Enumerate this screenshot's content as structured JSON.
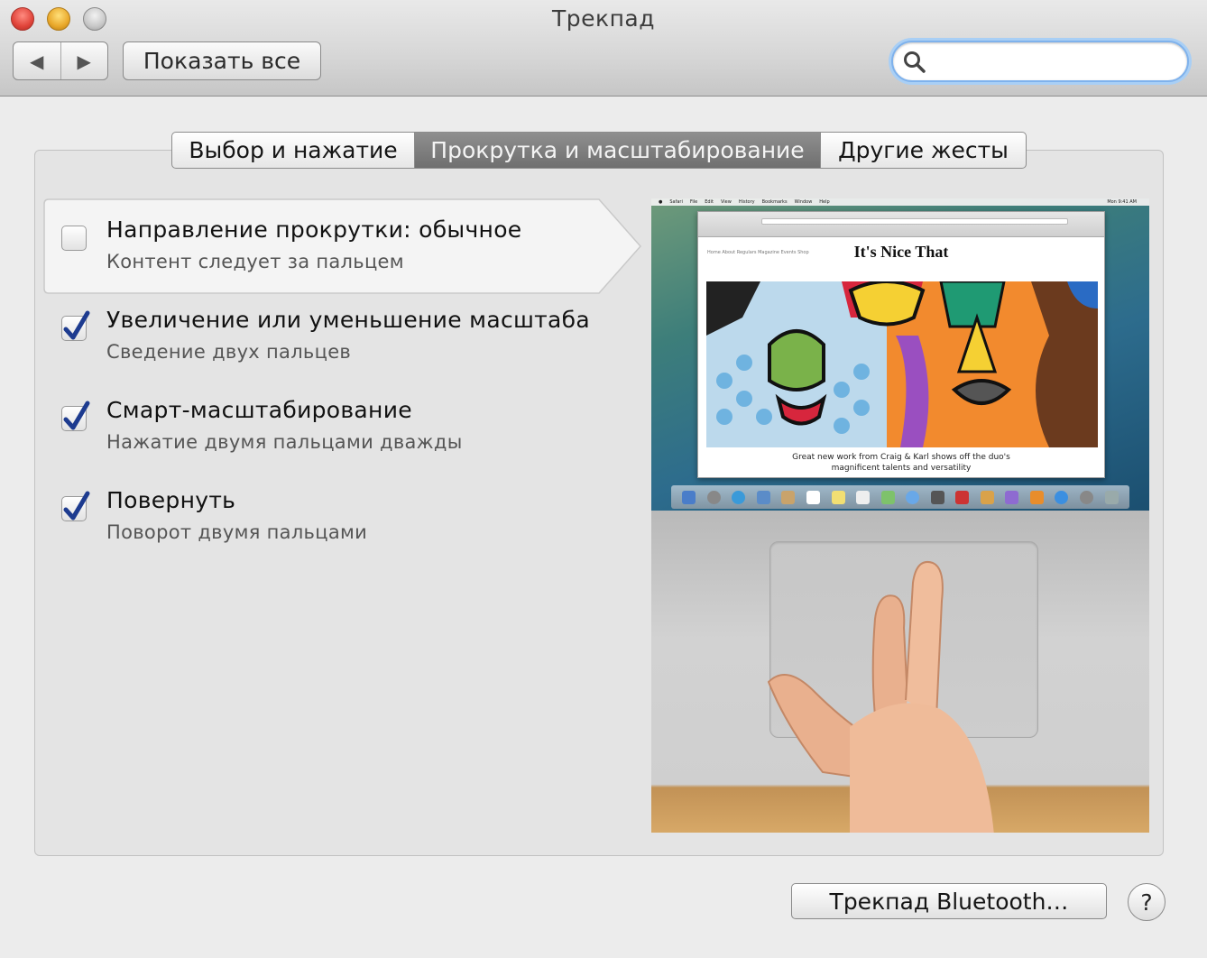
{
  "window": {
    "title": "Трекпад"
  },
  "toolbar": {
    "back_glyph": "◀",
    "forward_glyph": "▶",
    "show_all_label": "Показать все",
    "search_value": "",
    "search_placeholder": ""
  },
  "tabs": [
    {
      "label": "Выбор и нажатие",
      "selected": false
    },
    {
      "label": "Прокрутка и масштабирование",
      "selected": true
    },
    {
      "label": "Другие жесты",
      "selected": false
    }
  ],
  "options": [
    {
      "title": "Направление прокрутки: обычное",
      "subtitle": "Контент следует за пальцем",
      "checked": false,
      "highlighted": true
    },
    {
      "title": "Увеличение или уменьшение масштаба",
      "subtitle": "Сведение двух пальцев",
      "checked": true,
      "highlighted": false
    },
    {
      "title": "Смарт-масштабирование",
      "subtitle": "Нажатие двумя пальцами дважды",
      "checked": true,
      "highlighted": false
    },
    {
      "title": "Повернуть",
      "subtitle": "Поворот двумя пальцами",
      "checked": true,
      "highlighted": false
    }
  ],
  "preview": {
    "menu_items": [
      "Safari",
      "File",
      "Edit",
      "View",
      "History",
      "Bookmarks",
      "Window",
      "Help"
    ],
    "clock": "Mon 9:41 AM",
    "site_title": "It's Nice That",
    "site_nav": "Home   About   Regulars   Magazine   Events   Shop",
    "caption_line1": "Great new work from Craig & Karl shows off the duo's",
    "caption_line2": "magnificent talents and versatility"
  },
  "footer": {
    "bluetooth_label": "Трекпад Bluetooth…",
    "help_label": "?"
  },
  "colors": {
    "selected_tab": "#7f7f7f",
    "check": "#1d3b8f",
    "search_focus": "#7fb2ec"
  }
}
